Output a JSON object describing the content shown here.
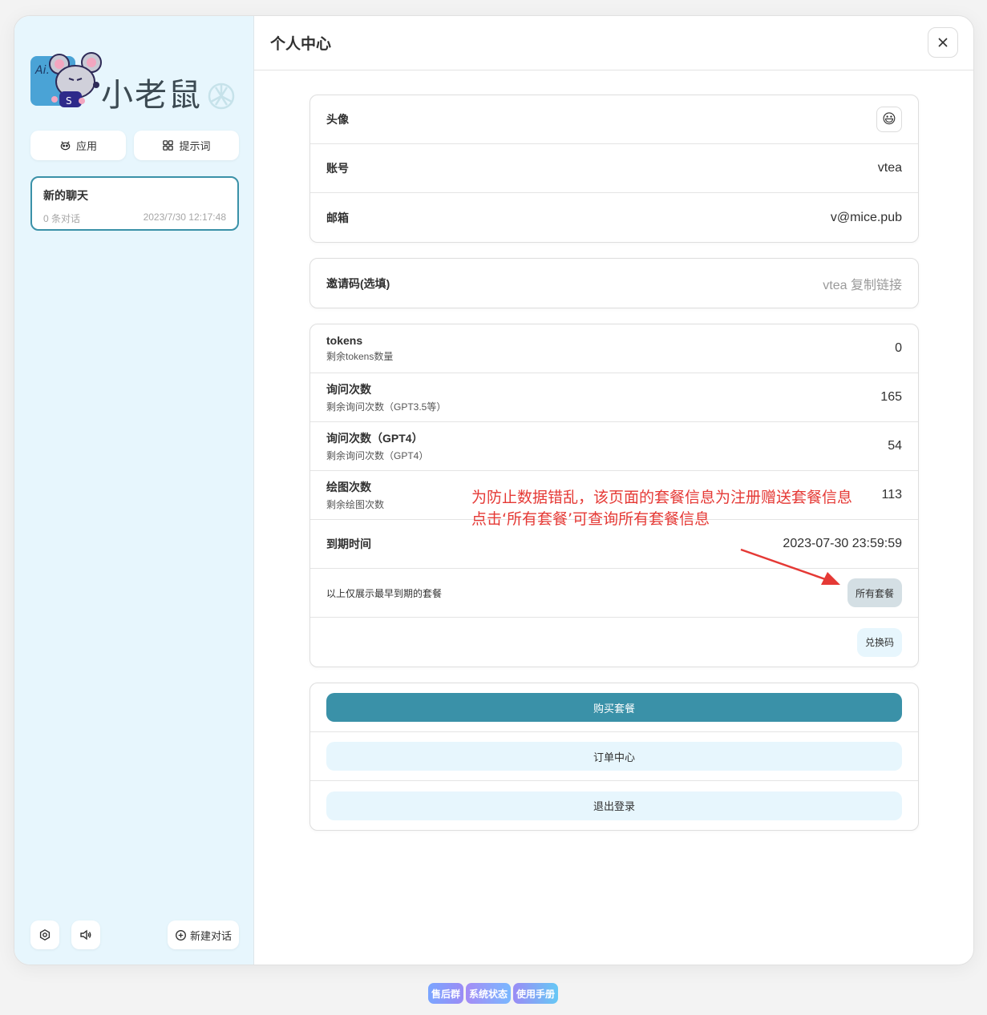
{
  "sidebar": {
    "logo_text": "小老鼠",
    "apps_label": "应用",
    "prompts_label": "提示词",
    "chat": {
      "title": "新的聊天",
      "count": "0 条对话",
      "time": "2023/7/30 12:17:48"
    },
    "new_chat_label": "新建对话"
  },
  "main": {
    "title": "个人中心",
    "profile": {
      "avatar_label": "头像",
      "avatar_emoji": "😃",
      "account_label": "账号",
      "account_value": "vtea",
      "email_label": "邮箱",
      "email_value": "v@mice.pub"
    },
    "invite": {
      "label": "邀请码(选填)",
      "value": "vtea 复制链接"
    },
    "package": {
      "tokens_label": "tokens",
      "tokens_sub": "剩余tokens数量",
      "tokens_value": "0",
      "queries_label": "询问次数",
      "queries_sub": "剩余询问次数（GPT3.5等）",
      "queries_value": "165",
      "gpt4_label": "询问次数（GPT4）",
      "gpt4_sub": "剩余询问次数（GPT4）",
      "gpt4_value": "54",
      "draw_label": "绘图次数",
      "draw_sub": "剩余绘图次数",
      "draw_value": "113",
      "expire_label": "到期时间",
      "expire_value": "2023-07-30 23:59:59",
      "note": "以上仅展示最早到期的套餐",
      "all_packages_button": "所有套餐",
      "redeem_button": "兑换码"
    },
    "actions": {
      "buy": "购买套餐",
      "orders": "订单中心",
      "logout": "退出登录"
    }
  },
  "annotation": {
    "line1": "为防止数据错乱，该页面的套餐信息为注册赠送套餐信息",
    "line2": "点击‘所有套餐’可查询所有套餐信息",
    "color": "#e53935"
  },
  "footer": {
    "links": [
      "售后群",
      "系统状态",
      "使用手册"
    ]
  },
  "colors": {
    "accent": "#3a91a8",
    "sidebar_bg": "#e7f6fd"
  }
}
